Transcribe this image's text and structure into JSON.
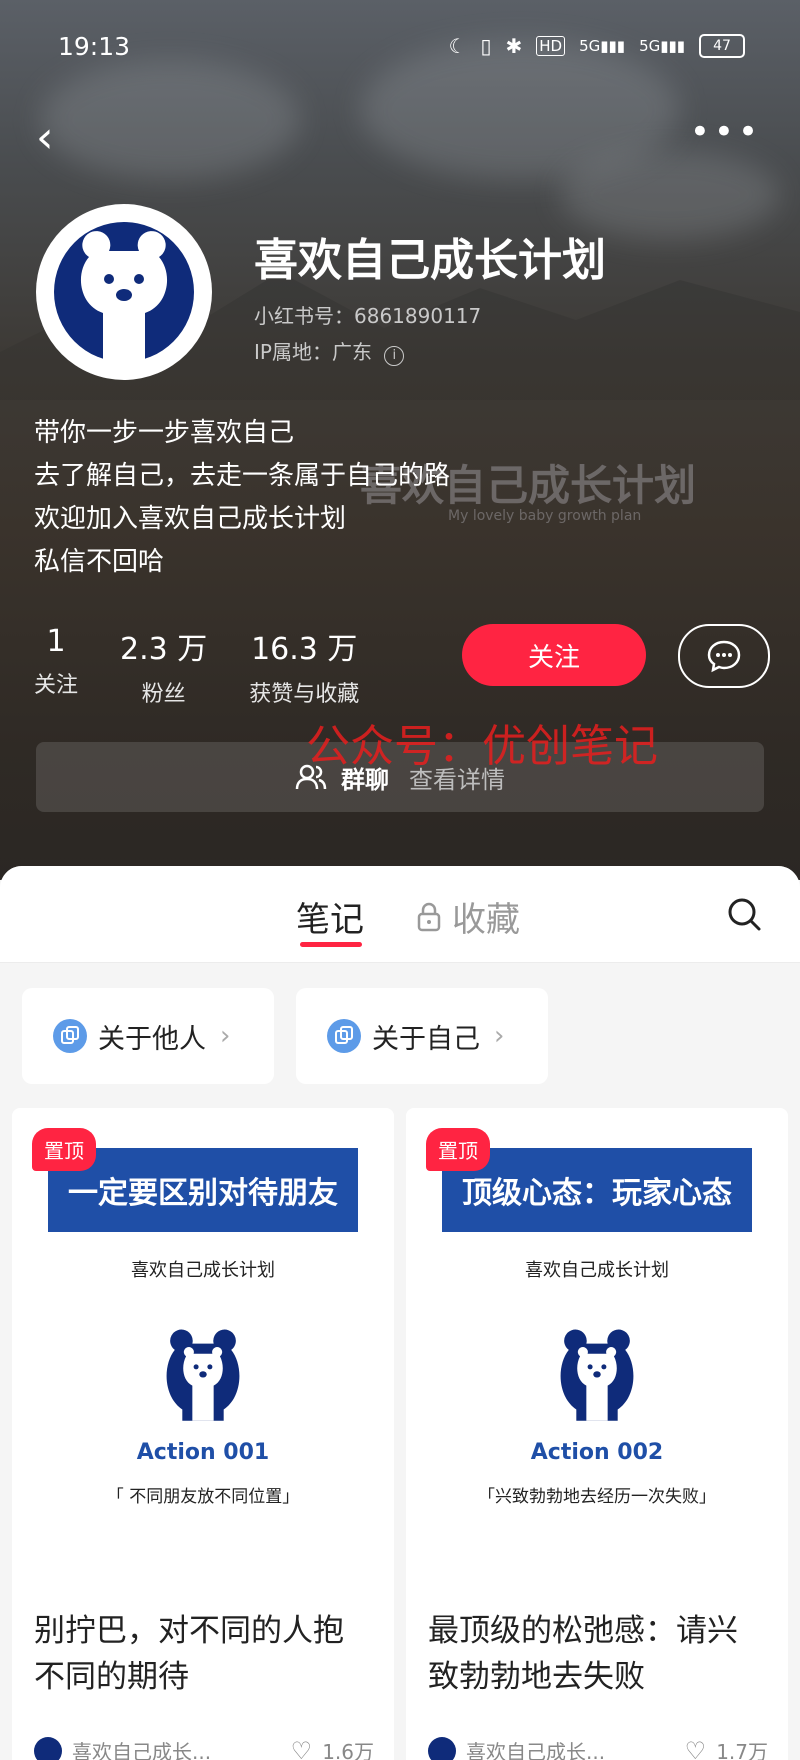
{
  "status_bar": {
    "time": "19:13",
    "battery": "47"
  },
  "profile": {
    "nickname": "喜欢自己成长计划",
    "redbook_id": "小红书号：6861890117",
    "ip_location": "IP属地：广东",
    "bio": [
      "带你一步一步喜欢自己",
      "去了解自己，去走一条属于自己的路",
      "欢迎加入喜欢自己成长计划",
      "私信不回哈"
    ],
    "background_text": "喜欢自己成长计划",
    "background_subtext": "My lovely baby growth plan"
  },
  "stats": [
    {
      "value": "1",
      "label": "关注"
    },
    {
      "value": "2.3 万",
      "label": "粉丝"
    },
    {
      "value": "16.3 万",
      "label": "获赞与收藏"
    }
  ],
  "actions": {
    "follow_label": "关注"
  },
  "watermark": "公众号：优创笔记",
  "group_chat": {
    "label": "群聊",
    "detail": "查看详情"
  },
  "tabs": {
    "notes": "笔记",
    "collections": "收藏"
  },
  "folders": [
    {
      "label": "关于他人"
    },
    {
      "label": "关于自己"
    }
  ],
  "cards": [
    {
      "pin": "置顶",
      "banner": "一定要区别对待朋友",
      "brand": "喜欢自己成长计划",
      "action": "Action 001",
      "quote": "「 不同朋友放不同位置」",
      "title": "别拧巴，对不同的人抱不同的期待",
      "author": "喜欢自己成长...",
      "likes": "1.6万"
    },
    {
      "pin": "置顶",
      "banner": "顶级心态：玩家心态",
      "brand": "喜欢自己成长计划",
      "action": "Action 002",
      "quote": "「兴致勃勃地去经历一次失败」",
      "title": "最顶级的松弛感：请兴致勃勃地去失败",
      "author": "喜欢自己成长...",
      "likes": "1.7万"
    }
  ],
  "colors": {
    "accent": "#ff2442",
    "brand_blue": "#1f4fa7",
    "bear_navy": "#0f2b7a"
  }
}
